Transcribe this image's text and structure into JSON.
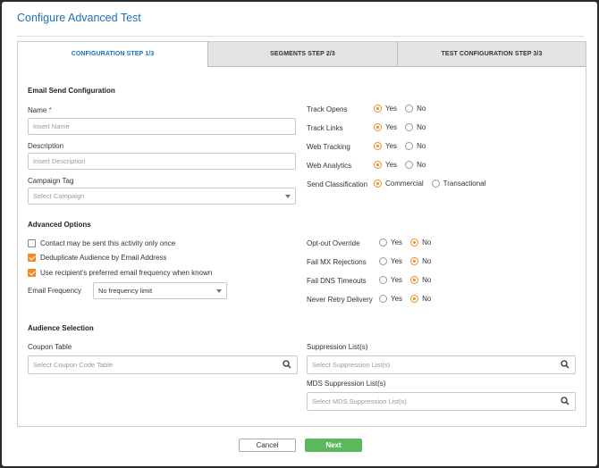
{
  "dialog": {
    "title": "Configure Advanced Test"
  },
  "tabs": [
    {
      "label": "CONFIGURATION STEP 1/3",
      "active": true
    },
    {
      "label": "SEGMENTS STEP 2/3",
      "active": false
    },
    {
      "label": "TEST CONFIGURATION STEP 3/3",
      "active": false
    }
  ],
  "email_send": {
    "title": "Email Send Configuration",
    "name_label": "Name",
    "name_required_mark": "*",
    "name_placeholder": "Insert Name",
    "description_label": "Description",
    "description_placeholder": "Insert Description",
    "campaign_label": "Campaign Tag",
    "campaign_placeholder": "Select Campaign",
    "track_opens": {
      "label": "Track Opens",
      "yes": "Yes",
      "no": "No",
      "selected": "Yes"
    },
    "track_links": {
      "label": "Track Links",
      "yes": "Yes",
      "no": "No",
      "selected": "Yes"
    },
    "web_tracking": {
      "label": "Web Tracking",
      "yes": "Yes",
      "no": "No",
      "selected": "Yes"
    },
    "web_analytics": {
      "label": "Web Analytics",
      "yes": "Yes",
      "no": "No",
      "selected": "Yes"
    },
    "send_classification": {
      "label": "Send Classification",
      "opt1": "Commercial",
      "opt2": "Transactional",
      "selected": "Commercial"
    }
  },
  "advanced": {
    "title": "Advanced Options",
    "contact_once": {
      "label": "Contact may be sent this activity only once",
      "checked": false
    },
    "dedupe": {
      "label": "Deduplicate Audience by Email Address",
      "checked": true
    },
    "preferred_freq": {
      "label": "Use recipient's preferred email frequency when known",
      "checked": true
    },
    "email_frequency_label": "Email Frequency",
    "email_frequency_value": "No frequency limit",
    "optout_override": {
      "label": "Opt-out Override",
      "yes": "Yes",
      "no": "No",
      "selected": "No"
    },
    "fail_mx": {
      "label": "Fail MX Rejections",
      "yes": "Yes",
      "no": "No",
      "selected": "No"
    },
    "fail_dns": {
      "label": "Fail DNS Timeouts",
      "yes": "Yes",
      "no": "No",
      "selected": "No"
    },
    "never_retry": {
      "label": "Never Retry Delivery",
      "yes": "Yes",
      "no": "No",
      "selected": "No"
    }
  },
  "audience": {
    "title": "Audience Selection",
    "coupon_label": "Coupon Table",
    "coupon_placeholder": "Select Coupon Code Table",
    "suppression_label": "Suppression List(s)",
    "suppression_placeholder": "Select Suppression List(s)",
    "mds_label": "MDS Suppression List(s)",
    "mds_placeholder": "Select MDS Suppression List(s)"
  },
  "footer": {
    "cancel_label": "Cancel",
    "next_label": "Next"
  },
  "colors": {
    "accent": "#1e6fb5",
    "radio_orange": "#f08a24",
    "next_green": "#5cb85c"
  }
}
